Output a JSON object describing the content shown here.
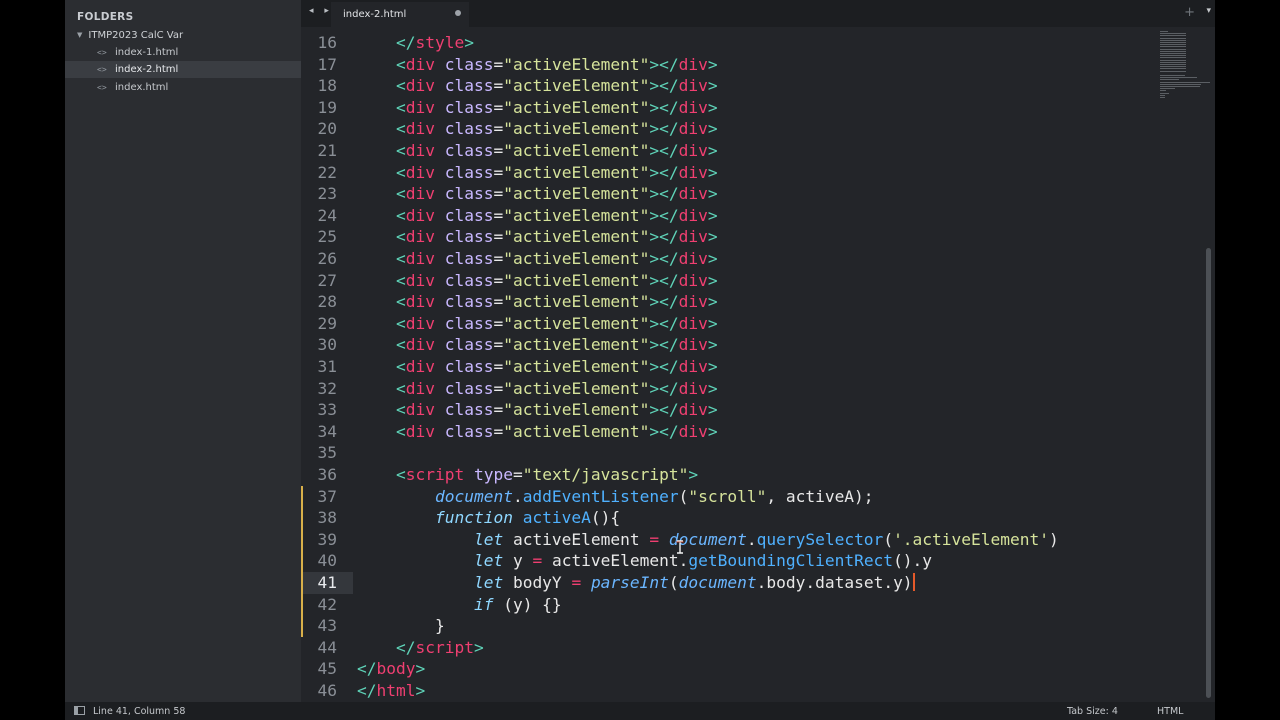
{
  "sidebar": {
    "title": "FOLDERS",
    "folder": "ITMP2023 CalC Var",
    "files": [
      {
        "name": "index-1.html",
        "selected": false
      },
      {
        "name": "index-2.html",
        "selected": true
      },
      {
        "name": "index.html",
        "selected": false
      }
    ]
  },
  "tabbar": {
    "nav": "◂ ▸",
    "tab_label": "index-2.html",
    "plus": "+",
    "menu": "▾"
  },
  "status": {
    "position": "Line 41, Column 58",
    "tab_size": "Tab Size: 4",
    "syntax": "HTML"
  },
  "editor": {
    "current_line": 41,
    "lines": [
      {
        "n": "16",
        "tokens": [
          [
            "t",
            "    "
          ],
          [
            "br",
            "</"
          ],
          [
            "tag",
            "style"
          ],
          [
            "br",
            ">"
          ]
        ]
      },
      {
        "n": "17",
        "tokens": [
          [
            "t",
            "    "
          ],
          [
            "br",
            "<"
          ],
          [
            "tag",
            "div"
          ],
          [
            "t",
            " "
          ],
          [
            "attr",
            "class"
          ],
          [
            "t",
            "="
          ],
          [
            "str",
            "\"activeElement\""
          ],
          [
            "br",
            "></"
          ],
          [
            "tag",
            "div"
          ],
          [
            "br",
            ">"
          ]
        ]
      },
      {
        "n": "18",
        "tokens": [
          [
            "t",
            "    "
          ],
          [
            "br",
            "<"
          ],
          [
            "tag",
            "div"
          ],
          [
            "t",
            " "
          ],
          [
            "attr",
            "class"
          ],
          [
            "t",
            "="
          ],
          [
            "str",
            "\"activeElement\""
          ],
          [
            "br",
            "></"
          ],
          [
            "tag",
            "div"
          ],
          [
            "br",
            ">"
          ]
        ]
      },
      {
        "n": "19",
        "tokens": [
          [
            "t",
            "    "
          ],
          [
            "br",
            "<"
          ],
          [
            "tag",
            "div"
          ],
          [
            "t",
            " "
          ],
          [
            "attr",
            "class"
          ],
          [
            "t",
            "="
          ],
          [
            "str",
            "\"activeElement\""
          ],
          [
            "br",
            "></"
          ],
          [
            "tag",
            "div"
          ],
          [
            "br",
            ">"
          ]
        ]
      },
      {
        "n": "20",
        "tokens": [
          [
            "t",
            "    "
          ],
          [
            "br",
            "<"
          ],
          [
            "tag",
            "div"
          ],
          [
            "t",
            " "
          ],
          [
            "attr",
            "class"
          ],
          [
            "t",
            "="
          ],
          [
            "str",
            "\"activeElement\""
          ],
          [
            "br",
            "></"
          ],
          [
            "tag",
            "div"
          ],
          [
            "br",
            ">"
          ]
        ]
      },
      {
        "n": "21",
        "tokens": [
          [
            "t",
            "    "
          ],
          [
            "br",
            "<"
          ],
          [
            "tag",
            "div"
          ],
          [
            "t",
            " "
          ],
          [
            "attr",
            "class"
          ],
          [
            "t",
            "="
          ],
          [
            "str",
            "\"activeElement\""
          ],
          [
            "br",
            "></"
          ],
          [
            "tag",
            "div"
          ],
          [
            "br",
            ">"
          ]
        ]
      },
      {
        "n": "22",
        "tokens": [
          [
            "t",
            "    "
          ],
          [
            "br",
            "<"
          ],
          [
            "tag",
            "div"
          ],
          [
            "t",
            " "
          ],
          [
            "attr",
            "class"
          ],
          [
            "t",
            "="
          ],
          [
            "str",
            "\"activeElement\""
          ],
          [
            "br",
            "></"
          ],
          [
            "tag",
            "div"
          ],
          [
            "br",
            ">"
          ]
        ]
      },
      {
        "n": "23",
        "tokens": [
          [
            "t",
            "    "
          ],
          [
            "br",
            "<"
          ],
          [
            "tag",
            "div"
          ],
          [
            "t",
            " "
          ],
          [
            "attr",
            "class"
          ],
          [
            "t",
            "="
          ],
          [
            "str",
            "\"activeElement\""
          ],
          [
            "br",
            "></"
          ],
          [
            "tag",
            "div"
          ],
          [
            "br",
            ">"
          ]
        ]
      },
      {
        "n": "24",
        "tokens": [
          [
            "t",
            "    "
          ],
          [
            "br",
            "<"
          ],
          [
            "tag",
            "div"
          ],
          [
            "t",
            " "
          ],
          [
            "attr",
            "class"
          ],
          [
            "t",
            "="
          ],
          [
            "str",
            "\"activeElement\""
          ],
          [
            "br",
            "></"
          ],
          [
            "tag",
            "div"
          ],
          [
            "br",
            ">"
          ]
        ]
      },
      {
        "n": "25",
        "tokens": [
          [
            "t",
            "    "
          ],
          [
            "br",
            "<"
          ],
          [
            "tag",
            "div"
          ],
          [
            "t",
            " "
          ],
          [
            "attr",
            "class"
          ],
          [
            "t",
            "="
          ],
          [
            "str",
            "\"activeElement\""
          ],
          [
            "br",
            "></"
          ],
          [
            "tag",
            "div"
          ],
          [
            "br",
            ">"
          ]
        ]
      },
      {
        "n": "26",
        "tokens": [
          [
            "t",
            "    "
          ],
          [
            "br",
            "<"
          ],
          [
            "tag",
            "div"
          ],
          [
            "t",
            " "
          ],
          [
            "attr",
            "class"
          ],
          [
            "t",
            "="
          ],
          [
            "str",
            "\"activeElement\""
          ],
          [
            "br",
            "></"
          ],
          [
            "tag",
            "div"
          ],
          [
            "br",
            ">"
          ]
        ]
      },
      {
        "n": "27",
        "tokens": [
          [
            "t",
            "    "
          ],
          [
            "br",
            "<"
          ],
          [
            "tag",
            "div"
          ],
          [
            "t",
            " "
          ],
          [
            "attr",
            "class"
          ],
          [
            "t",
            "="
          ],
          [
            "str",
            "\"activeElement\""
          ],
          [
            "br",
            "></"
          ],
          [
            "tag",
            "div"
          ],
          [
            "br",
            ">"
          ]
        ]
      },
      {
        "n": "28",
        "tokens": [
          [
            "t",
            "    "
          ],
          [
            "br",
            "<"
          ],
          [
            "tag",
            "div"
          ],
          [
            "t",
            " "
          ],
          [
            "attr",
            "class"
          ],
          [
            "t",
            "="
          ],
          [
            "str",
            "\"activeElement\""
          ],
          [
            "br",
            "></"
          ],
          [
            "tag",
            "div"
          ],
          [
            "br",
            ">"
          ]
        ]
      },
      {
        "n": "29",
        "tokens": [
          [
            "t",
            "    "
          ],
          [
            "br",
            "<"
          ],
          [
            "tag",
            "div"
          ],
          [
            "t",
            " "
          ],
          [
            "attr",
            "class"
          ],
          [
            "t",
            "="
          ],
          [
            "str",
            "\"activeElement\""
          ],
          [
            "br",
            "></"
          ],
          [
            "tag",
            "div"
          ],
          [
            "br",
            ">"
          ]
        ]
      },
      {
        "n": "30",
        "tokens": [
          [
            "t",
            "    "
          ],
          [
            "br",
            "<"
          ],
          [
            "tag",
            "div"
          ],
          [
            "t",
            " "
          ],
          [
            "attr",
            "class"
          ],
          [
            "t",
            "="
          ],
          [
            "str",
            "\"activeElement\""
          ],
          [
            "br",
            "></"
          ],
          [
            "tag",
            "div"
          ],
          [
            "br",
            ">"
          ]
        ]
      },
      {
        "n": "31",
        "tokens": [
          [
            "t",
            "    "
          ],
          [
            "br",
            "<"
          ],
          [
            "tag",
            "div"
          ],
          [
            "t",
            " "
          ],
          [
            "attr",
            "class"
          ],
          [
            "t",
            "="
          ],
          [
            "str",
            "\"activeElement\""
          ],
          [
            "br",
            "></"
          ],
          [
            "tag",
            "div"
          ],
          [
            "br",
            ">"
          ]
        ]
      },
      {
        "n": "32",
        "tokens": [
          [
            "t",
            "    "
          ],
          [
            "br",
            "<"
          ],
          [
            "tag",
            "div"
          ],
          [
            "t",
            " "
          ],
          [
            "attr",
            "class"
          ],
          [
            "t",
            "="
          ],
          [
            "str",
            "\"activeElement\""
          ],
          [
            "br",
            "></"
          ],
          [
            "tag",
            "div"
          ],
          [
            "br",
            ">"
          ]
        ]
      },
      {
        "n": "33",
        "tokens": [
          [
            "t",
            "    "
          ],
          [
            "br",
            "<"
          ],
          [
            "tag",
            "div"
          ],
          [
            "t",
            " "
          ],
          [
            "attr",
            "class"
          ],
          [
            "t",
            "="
          ],
          [
            "str",
            "\"activeElement\""
          ],
          [
            "br",
            "></"
          ],
          [
            "tag",
            "div"
          ],
          [
            "br",
            ">"
          ]
        ]
      },
      {
        "n": "34",
        "tokens": [
          [
            "t",
            "    "
          ],
          [
            "br",
            "<"
          ],
          [
            "tag",
            "div"
          ],
          [
            "t",
            " "
          ],
          [
            "attr",
            "class"
          ],
          [
            "t",
            "="
          ],
          [
            "str",
            "\"activeElement\""
          ],
          [
            "br",
            "></"
          ],
          [
            "tag",
            "div"
          ],
          [
            "br",
            ">"
          ]
        ]
      },
      {
        "n": "35",
        "tokens": []
      },
      {
        "n": "36",
        "tokens": [
          [
            "t",
            "    "
          ],
          [
            "br",
            "<"
          ],
          [
            "tag",
            "script"
          ],
          [
            "t",
            " "
          ],
          [
            "attr",
            "type"
          ],
          [
            "t",
            "="
          ],
          [
            "str",
            "\"text/javascript\""
          ],
          [
            "br",
            ">"
          ]
        ]
      },
      {
        "n": "37",
        "tokens": [
          [
            "t",
            "        "
          ],
          [
            "bi",
            "document"
          ],
          [
            "t",
            "."
          ],
          [
            "fn",
            "addEventListener"
          ],
          [
            "t",
            "("
          ],
          [
            "str",
            "\"scroll\""
          ],
          [
            "t",
            ", activeA);"
          ]
        ]
      },
      {
        "n": "38",
        "tokens": [
          [
            "t",
            "        "
          ],
          [
            "kw",
            "function"
          ],
          [
            "t",
            " "
          ],
          [
            "fn",
            "activeA"
          ],
          [
            "t",
            "(){"
          ]
        ]
      },
      {
        "n": "39",
        "tokens": [
          [
            "t",
            "            "
          ],
          [
            "kw",
            "let"
          ],
          [
            "t",
            " activeElement "
          ],
          [
            "op",
            "="
          ],
          [
            "t",
            " "
          ],
          [
            "bi",
            "document"
          ],
          [
            "t",
            "."
          ],
          [
            "fn",
            "querySelector"
          ],
          [
            "t",
            "("
          ],
          [
            "str",
            "'.activeElement'"
          ],
          [
            "t",
            ")"
          ]
        ]
      },
      {
        "n": "40",
        "tokens": [
          [
            "t",
            "            "
          ],
          [
            "kw",
            "let"
          ],
          [
            "t",
            " y "
          ],
          [
            "op",
            "="
          ],
          [
            "t",
            " activeElement."
          ],
          [
            "fn",
            "getBoundingClientRect"
          ],
          [
            "t",
            "().y"
          ]
        ]
      },
      {
        "n": "41",
        "tokens": [
          [
            "t",
            "            "
          ],
          [
            "kw",
            "let"
          ],
          [
            "t",
            " bodyY "
          ],
          [
            "op",
            "="
          ],
          [
            "t",
            " "
          ],
          [
            "bi",
            "parseInt"
          ],
          [
            "t",
            "("
          ],
          [
            "bi",
            "document"
          ],
          [
            "t",
            ".body.dataset.y)"
          ]
        ]
      },
      {
        "n": "42",
        "tokens": [
          [
            "t",
            "            "
          ],
          [
            "kw",
            "if"
          ],
          [
            "t",
            " (y) {}"
          ]
        ]
      },
      {
        "n": "43",
        "tokens": [
          [
            "t",
            "        }"
          ]
        ]
      },
      {
        "n": "44",
        "tokens": [
          [
            "t",
            "    "
          ],
          [
            "br",
            "</"
          ],
          [
            "tag",
            "script"
          ],
          [
            "br",
            ">"
          ]
        ]
      },
      {
        "n": "45",
        "tokens": [
          [
            "br",
            "</"
          ],
          [
            "tag",
            "body"
          ],
          [
            "br",
            ">"
          ]
        ]
      },
      {
        "n": "46",
        "tokens": [
          [
            "br",
            "</"
          ],
          [
            "tag",
            "html"
          ],
          [
            "br",
            ">"
          ]
        ]
      }
    ]
  }
}
